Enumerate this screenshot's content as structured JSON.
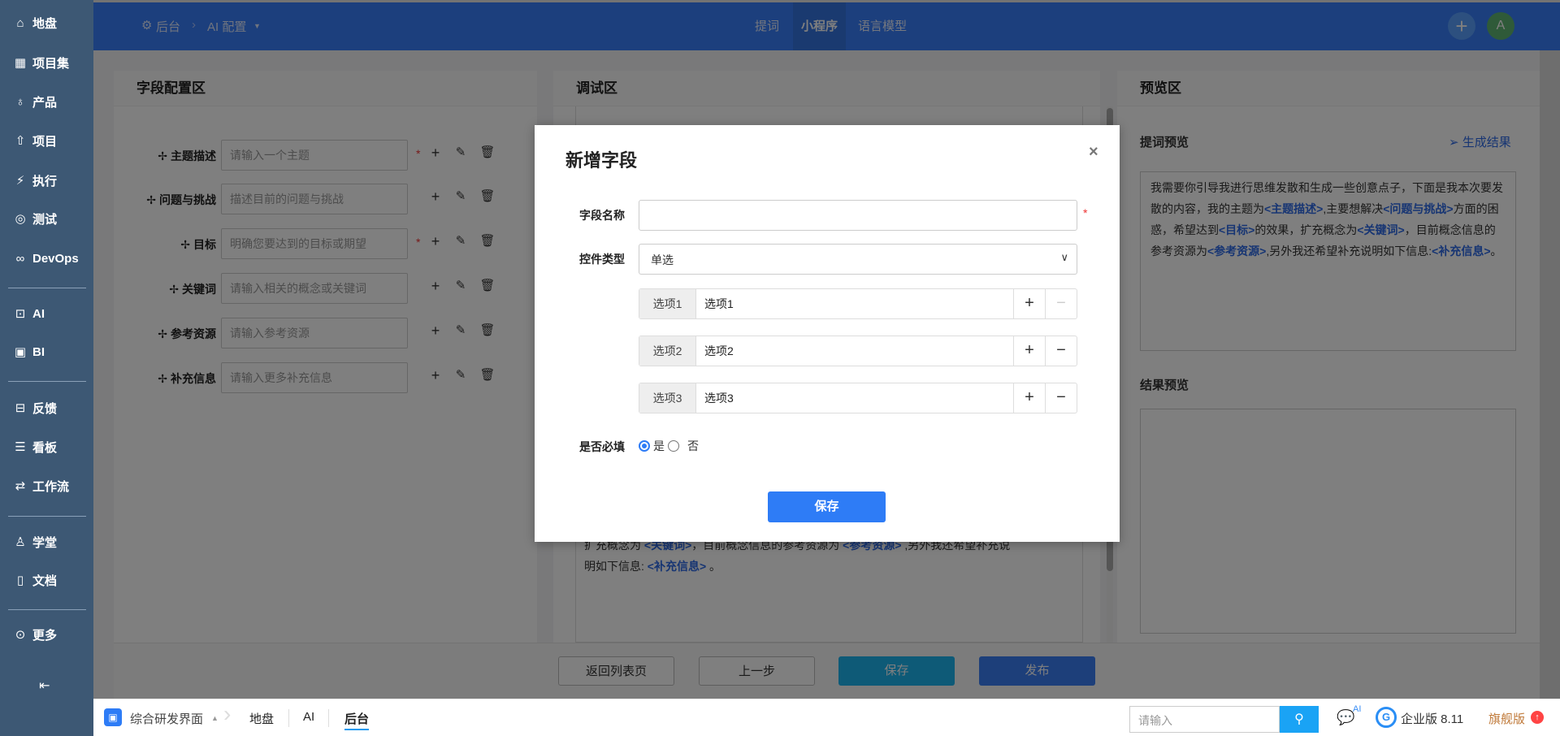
{
  "sidebar": {
    "items": [
      {
        "label": "地盘",
        "icon": "home-icon"
      },
      {
        "label": "项目集",
        "icon": "grid-icon"
      },
      {
        "label": "产品",
        "icon": "bulb-icon"
      },
      {
        "label": "项目",
        "icon": "rocket-icon"
      },
      {
        "label": "执行",
        "icon": "run-icon"
      },
      {
        "label": "测试",
        "icon": "test-icon"
      },
      {
        "label": "DevOps",
        "icon": "infinity-icon"
      },
      {
        "label": "AI",
        "icon": "robot-icon"
      },
      {
        "label": "BI",
        "icon": "chart-board-icon"
      },
      {
        "label": "反馈",
        "icon": "feedback-icon"
      },
      {
        "label": "看板",
        "icon": "kanban-icon"
      },
      {
        "label": "工作流",
        "icon": "workflow-icon"
      },
      {
        "label": "学堂",
        "icon": "school-icon"
      },
      {
        "label": "文档",
        "icon": "doc-icon"
      },
      {
        "label": "更多",
        "icon": "more-icon"
      }
    ]
  },
  "header": {
    "breadcrumb": [
      "后台",
      "AI 配置"
    ],
    "tabs": [
      {
        "label": "提词",
        "active": false
      },
      {
        "label": "小程序",
        "active": true
      },
      {
        "label": "语言模型",
        "active": false
      }
    ],
    "avatar": "A"
  },
  "field_panel": {
    "title": "字段配置区",
    "fields": [
      {
        "label": "主题描述",
        "placeholder": "请输入一个主题",
        "required": true
      },
      {
        "label": "问题与挑战",
        "placeholder": "描述目前的问题与挑战",
        "required": false
      },
      {
        "label": "目标",
        "placeholder": "明确您要达到的目标或期望",
        "required": true
      },
      {
        "label": "关键词",
        "placeholder": "请输入相关的概念或关键词",
        "required": false
      },
      {
        "label": "参考资源",
        "placeholder": "请输入参考资源",
        "required": false
      },
      {
        "label": "补充信息",
        "placeholder": "请输入更多补充信息",
        "required": false
      }
    ],
    "required_mark": "*"
  },
  "debug_panel": {
    "title": "调试区",
    "text_line1": [
      "扩充概念为 ",
      "<关键词>",
      "，目前概念信息的参考资源为 ",
      "<参考资源>",
      " ,另外我还希望补充说"
    ],
    "text_line2": [
      "明如下信息: ",
      "<补充信息>",
      " 。"
    ]
  },
  "preview_panel": {
    "title": "预览区",
    "prompt_title": "提词预览",
    "generate_label": "生成结果",
    "prompt_segments": [
      "我需要你引导我进行思维发散和生成一些创意点子，下面是我本次要发散的内容，我的主题为",
      "<主题描述>",
      ",主要想解决",
      "<问题与挑战>",
      "方面的困惑，希望达到",
      "<目标>",
      "的效果，扩充概念为",
      "<关键词>",
      "，目前概念信息的参考资源为",
      "<参考资源>",
      ",另外我还希望补充说明如下信息:",
      "<补充信息>",
      "。"
    ],
    "result_title": "结果预览"
  },
  "footer_buttons": {
    "back": "返回列表页",
    "prev": "上一步",
    "save": "保存",
    "publish": "发布"
  },
  "modal": {
    "title": "新增字段",
    "close": "×",
    "name_label": "字段名称",
    "name_value": "",
    "type_label": "控件类型",
    "type_value": "单选",
    "options": [
      {
        "addon": "选项1",
        "value": "选项1"
      },
      {
        "addon": "选项2",
        "value": "选项2"
      },
      {
        "addon": "选项3",
        "value": "选项3"
      }
    ],
    "required_label": "是否必填",
    "required_yes": "是",
    "required_no": "否",
    "required_selected": "是",
    "save": "保存",
    "required_mark": "*"
  },
  "bottombar": {
    "app": "综合研发界面",
    "crumbs": [
      "地盘",
      "AI",
      "后台"
    ],
    "search_placeholder": "请输入",
    "ai_badge": "AI",
    "edition": "企业版 8.11",
    "flagship": "旗舰版"
  },
  "colors": {
    "primary": "#387efa",
    "sidebar": "#3d5874",
    "link": "#2e6be6",
    "save": "#1cb4ef",
    "publish": "#3a7ef5"
  }
}
